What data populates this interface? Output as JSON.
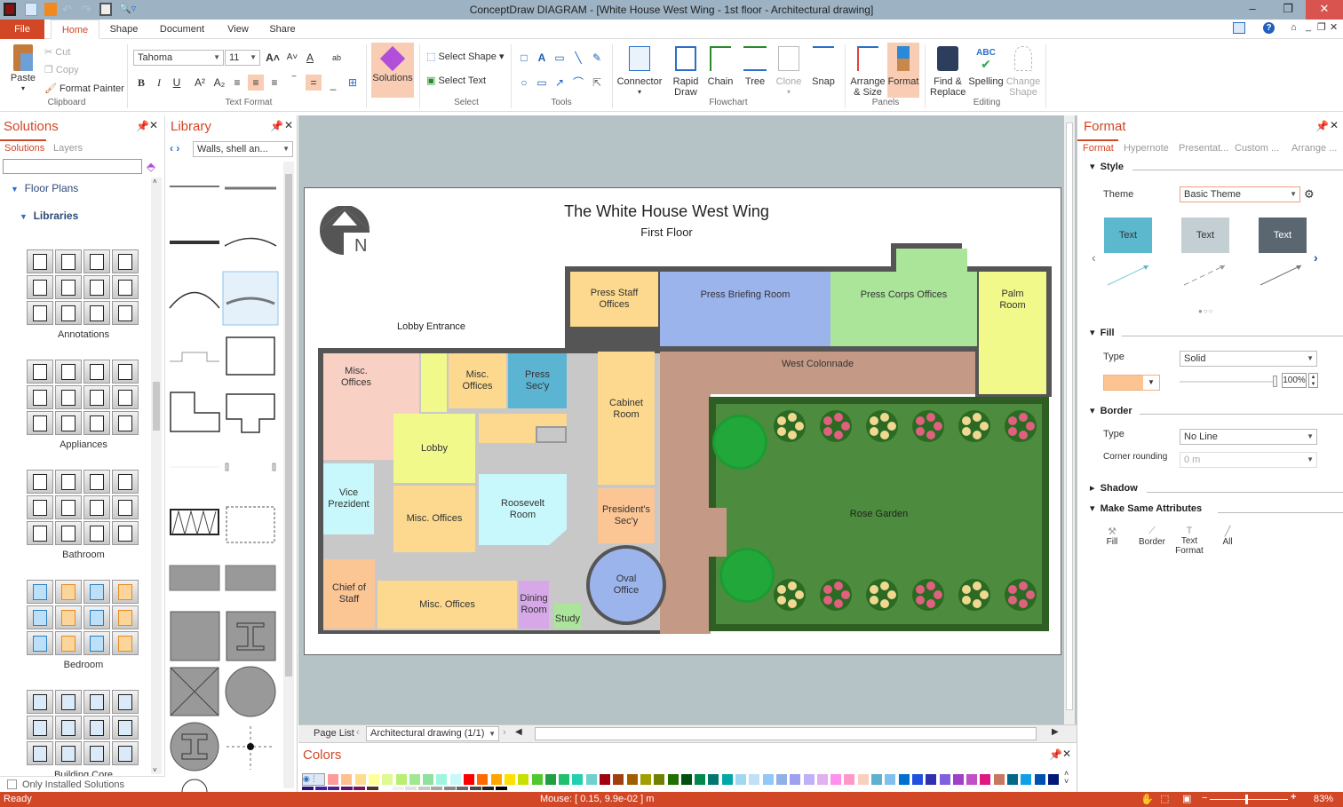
{
  "window": {
    "title": "ConceptDraw DIAGRAM - [White House West Wing - 1st floor - Architectural drawing]",
    "controls": {
      "minimize": "–",
      "restore": "❐",
      "close": "✕"
    }
  },
  "tabs": [
    {
      "label": "File"
    },
    {
      "label": "Home",
      "active": true
    },
    {
      "label": "Shape"
    },
    {
      "label": "Document"
    },
    {
      "label": "View"
    },
    {
      "label": "Share"
    }
  ],
  "ribbon": {
    "clipboard": {
      "paste": "Paste",
      "cut": "Cut",
      "copy": "Copy",
      "format_painter": "Format Painter",
      "group": "Clipboard"
    },
    "text_format": {
      "font": "Tahoma",
      "size": "11",
      "group": "Text Format"
    },
    "solutions": {
      "label": "Solutions"
    },
    "select": {
      "select_shape": "Select Shape",
      "select_text": "Select Text",
      "group": "Select"
    },
    "tools": {
      "group": "Tools"
    },
    "flowchart": {
      "connector": "Connector",
      "rapid_draw": "Rapid Draw",
      "chain": "Chain",
      "tree": "Tree",
      "clone": "Clone",
      "snap": "Snap",
      "group": "Flowchart"
    },
    "panels": {
      "arrange": "Arrange & Size",
      "format": "Format",
      "group": "Panels"
    },
    "editing": {
      "find": "Find & Replace",
      "spelling": "Spelling",
      "change_shape": "Change Shape",
      "group": "Editing"
    }
  },
  "solutions_panel": {
    "title": "Solutions",
    "tabs": [
      "Solutions",
      "Layers"
    ],
    "search_value": "",
    "tree": {
      "floor_plans": "Floor Plans",
      "libraries": "Libraries"
    },
    "groups": [
      "Annotations",
      "Appliances",
      "Bathroom",
      "Bedroom",
      "Building Core"
    ],
    "only_installed": "Only Installed Solutions"
  },
  "library_panel": {
    "title": "Library",
    "selected_library": "Walls, shell an..."
  },
  "diagram": {
    "title": "The White House West Wing",
    "subtitle": "First Floor",
    "compass": "N",
    "lobby_entrance": "Lobby Entrance",
    "rooms": {
      "press_staff": "Press Staff Offices",
      "press_briefing": "Press Briefing Room",
      "press_corps": "Press Corps Offices",
      "palm_room": "Palm Room",
      "misc1": "Misc. Offices",
      "misc2": "Misc. Offices",
      "press_secy": "Press Sec'y",
      "cabinet": "Cabinet Room",
      "west_colonnade": "West Colonnade",
      "lobby": "Lobby",
      "vice": "Vice Prezident",
      "misc3": "Misc. Offices",
      "roosevelt": "Roosevelt Room",
      "presidents_secy": "President's Sec'y",
      "rose_garden": "Rose Garden",
      "chief": "Chief of Staff",
      "misc4": "Misc. Offices",
      "dining": "Dining Room",
      "study": "Study",
      "oval": "Oval Office"
    },
    "colors": {
      "peach": "#f9d1c4",
      "yellow": "#f0f98a",
      "orange": "#fcd98e",
      "blue": "#5bb4d2",
      "lightblue": "#c8f8fb",
      "periwinkle": "#9cb4ec",
      "green": "#aae59a",
      "brown": "#c49a86",
      "salmon": "#fbc594",
      "lilac": "#d7a8e8",
      "grass": "#4d8c3e",
      "hedge": "#2f5e24"
    }
  },
  "page_list": {
    "label": "Page List",
    "current": "Architectural drawing (1/1)"
  },
  "colors_panel": {
    "title": "Colors",
    "swatches": [
      "#ff9a9a",
      "#ffc090",
      "#ffdb90",
      "#ffff99",
      "#e0f990",
      "#b8ef70",
      "#a0e890",
      "#90e0a0",
      "#9ef5e0",
      "#c8f8f8",
      "#ff0000",
      "#ff6a00",
      "#ffa500",
      "#ffe000",
      "#c8e000",
      "#50c830",
      "#20a040",
      "#20c070",
      "#20d0b0",
      "#70d0d0",
      "#a00010",
      "#a04010",
      "#a06000",
      "#a0a000",
      "#708000",
      "#207000",
      "#005010",
      "#008850",
      "#007870",
      "#00a8a8",
      "#a0d8f0",
      "#c0e0f8",
      "#90c8f8",
      "#90b0e8",
      "#a0a0f0",
      "#c0b0f8",
      "#e0b0f0",
      "#ff90f0",
      "#ff98c8",
      "#f8d0c0",
      "#60b0d0",
      "#80c0f0",
      "#0070d0",
      "#2050e0",
      "#3030b0",
      "#8060e0",
      "#a040c8",
      "#c050c8",
      "#e01880",
      "#c87860",
      "#006888",
      "#10a0e8",
      "#0050b0",
      "#001878"
    ],
    "greys": [
      "#301080",
      "#4020a0",
      "#502090",
      "#601070",
      "#801060",
      "#503020",
      "#ffffff",
      "#f0f0f0",
      "#e0e0e0",
      "#c8c8c8",
      "#a8a8a8",
      "#888888",
      "#686868",
      "#484848",
      "#202020",
      "#000000"
    ]
  },
  "format_panel": {
    "title": "Format",
    "tabs": [
      "Format",
      "Hypernote",
      "Presentat...",
      "Custom ...",
      "Arrange ..."
    ],
    "style": {
      "header": "Style",
      "theme_label": "Theme",
      "theme_value": "Basic Theme",
      "cards": [
        "Text",
        "Text",
        "Text"
      ],
      "card_colors": [
        "#5cb8cc",
        "#c3cfd3",
        "#5a6670"
      ]
    },
    "fill": {
      "header": "Fill",
      "type_label": "Type",
      "type_value": "Solid",
      "color": "#fcc393",
      "opacity": "100%",
      "opacity_fraction": 1.0
    },
    "border": {
      "header": "Border",
      "type_label": "Type",
      "type_value": "No Line",
      "rounding_label": "Corner rounding",
      "rounding_value": "0 m"
    },
    "shadow": {
      "header": "Shadow"
    },
    "make_same": {
      "header": "Make Same Attributes",
      "buttons": [
        "Fill",
        "Border",
        "Text Format",
        "All"
      ]
    }
  },
  "status": {
    "left": "Ready",
    "mouse": "Mouse: [ 0.15, 9.9e-02 ] m",
    "zoom": "83%",
    "zoom_fraction": 0.83
  }
}
